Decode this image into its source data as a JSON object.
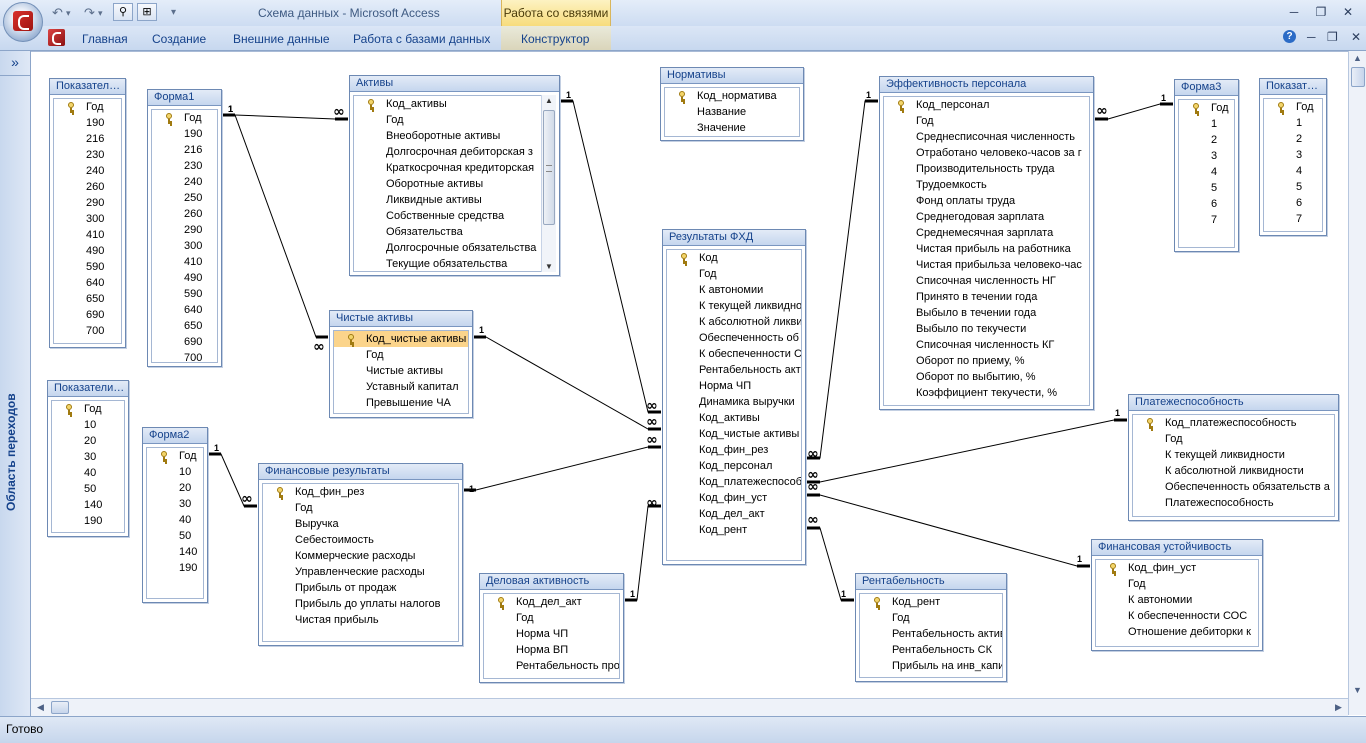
{
  "window": {
    "title": "Схема данных - Microsoft Access",
    "context_tab": "Работа со связями"
  },
  "ribbon": {
    "tabs": [
      "Главная",
      "Создание",
      "Внешние данные",
      "Работа с базами данных",
      "Конструктор"
    ]
  },
  "nav_pane": {
    "label": "Область переходов"
  },
  "status": {
    "text": "Готово"
  },
  "tables": [
    {
      "id": "pokaz1",
      "title": "Показател…",
      "fields": [
        {
          "n": "Год",
          "k": true
        },
        {
          "n": "190"
        },
        {
          "n": "216"
        },
        {
          "n": "230"
        },
        {
          "n": "240"
        },
        {
          "n": "260"
        },
        {
          "n": "290"
        },
        {
          "n": "300"
        },
        {
          "n": "410"
        },
        {
          "n": "490"
        },
        {
          "n": "590"
        },
        {
          "n": "640"
        },
        {
          "n": "650"
        },
        {
          "n": "690"
        },
        {
          "n": "700"
        }
      ]
    },
    {
      "id": "forma1",
      "title": "Форма1",
      "fields": [
        {
          "n": "Год",
          "k": true
        },
        {
          "n": "190"
        },
        {
          "n": "216"
        },
        {
          "n": "230"
        },
        {
          "n": "240"
        },
        {
          "n": "250"
        },
        {
          "n": "260"
        },
        {
          "n": "290"
        },
        {
          "n": "300"
        },
        {
          "n": "410"
        },
        {
          "n": "490"
        },
        {
          "n": "590"
        },
        {
          "n": "640"
        },
        {
          "n": "650"
        },
        {
          "n": "690"
        },
        {
          "n": "700"
        }
      ]
    },
    {
      "id": "aktivy",
      "title": "Активы",
      "fields": [
        {
          "n": "Код_активы",
          "k": true
        },
        {
          "n": "Год"
        },
        {
          "n": "Внеоборотные активы"
        },
        {
          "n": "Долгосрочная дебиторская з"
        },
        {
          "n": "Краткосрочная кредиторская"
        },
        {
          "n": "Оборотные активы"
        },
        {
          "n": "Ликвидные активы"
        },
        {
          "n": "Собственные средства"
        },
        {
          "n": "Обязательства"
        },
        {
          "n": "Долгосрочные обязательства"
        },
        {
          "n": "Текущие обязательства"
        }
      ]
    },
    {
      "id": "normativy",
      "title": "Нормативы",
      "fields": [
        {
          "n": "Код_норматива",
          "k": true
        },
        {
          "n": "Название"
        },
        {
          "n": "Значение"
        }
      ]
    },
    {
      "id": "effekt",
      "title": "Эффективность персонала",
      "fields": [
        {
          "n": "Код_персонал",
          "k": true
        },
        {
          "n": "Год"
        },
        {
          "n": "Среднесписочная численность"
        },
        {
          "n": "Отработано человеко-часов за г"
        },
        {
          "n": "Производительность труда"
        },
        {
          "n": "Трудоемкость"
        },
        {
          "n": "Фонд оплаты труда"
        },
        {
          "n": "Среднегодовая зарплата"
        },
        {
          "n": "Среднемесячная зарплата"
        },
        {
          "n": "Чистая прибыль на работника"
        },
        {
          "n": "Чистая прибыльза человеко-час"
        },
        {
          "n": "Списочная численность НГ"
        },
        {
          "n": "Принято в течении года"
        },
        {
          "n": "Выбыло в течении года"
        },
        {
          "n": "Выбыло по текучести"
        },
        {
          "n": "Списочная численность КГ"
        },
        {
          "n": "Оборот по приему, %"
        },
        {
          "n": "Оборот по выбытию, %"
        },
        {
          "n": "Коэффициент текучести, %"
        }
      ]
    },
    {
      "id": "forma3",
      "title": "Форма3",
      "fields": [
        {
          "n": "Год",
          "k": true
        },
        {
          "n": "1"
        },
        {
          "n": "2"
        },
        {
          "n": "3"
        },
        {
          "n": "4"
        },
        {
          "n": "5"
        },
        {
          "n": "6"
        },
        {
          "n": "7"
        }
      ]
    },
    {
      "id": "pokaz3",
      "title": "Показат…",
      "fields": [
        {
          "n": "Год",
          "k": true
        },
        {
          "n": "1"
        },
        {
          "n": "2"
        },
        {
          "n": "3"
        },
        {
          "n": "4"
        },
        {
          "n": "5"
        },
        {
          "n": "6"
        },
        {
          "n": "7"
        }
      ]
    },
    {
      "id": "chistye",
      "title": "Чистые активы",
      "fields": [
        {
          "n": "Код_чистые активы",
          "k": true,
          "sel": true
        },
        {
          "n": "Год"
        },
        {
          "n": "Чистые активы"
        },
        {
          "n": "Уставный капитал"
        },
        {
          "n": "Превышение ЧА"
        }
      ]
    },
    {
      "id": "rezfhd",
      "title": "Результаты ФХД",
      "fields": [
        {
          "n": "Код",
          "k": true
        },
        {
          "n": "Год"
        },
        {
          "n": "К автономии"
        },
        {
          "n": "К текущей ликвидност"
        },
        {
          "n": "К абсолютной ликви"
        },
        {
          "n": "Обеспеченность об"
        },
        {
          "n": "К обеспеченности С"
        },
        {
          "n": "Рентабельность акт"
        },
        {
          "n": "Норма ЧП"
        },
        {
          "n": "Динамика выручки"
        },
        {
          "n": "Код_активы"
        },
        {
          "n": "Код_чистые активы"
        },
        {
          "n": "Код_фин_рез"
        },
        {
          "n": "Код_персонал"
        },
        {
          "n": "Код_платежеспособ"
        },
        {
          "n": "Код_фин_уст"
        },
        {
          "n": "Код_дел_акт"
        },
        {
          "n": "Код_рент"
        }
      ]
    },
    {
      "id": "pokaz2",
      "title": "Показатели…",
      "fields": [
        {
          "n": "Год",
          "k": true
        },
        {
          "n": "10"
        },
        {
          "n": "20"
        },
        {
          "n": "30"
        },
        {
          "n": "40"
        },
        {
          "n": "50"
        },
        {
          "n": "140"
        },
        {
          "n": "190"
        }
      ]
    },
    {
      "id": "forma2",
      "title": "Форма2",
      "fields": [
        {
          "n": "Год",
          "k": true
        },
        {
          "n": "10"
        },
        {
          "n": "20"
        },
        {
          "n": "30"
        },
        {
          "n": "40"
        },
        {
          "n": "50"
        },
        {
          "n": "140"
        },
        {
          "n": "190"
        }
      ]
    },
    {
      "id": "finrez",
      "title": "Финансовые результаты",
      "fields": [
        {
          "n": "Код_фин_рез",
          "k": true
        },
        {
          "n": "Год"
        },
        {
          "n": "Выручка"
        },
        {
          "n": "Себестоимость"
        },
        {
          "n": "Коммерческие расходы"
        },
        {
          "n": "Управленческие расходы"
        },
        {
          "n": "Прибыль от продаж"
        },
        {
          "n": "Прибыль до уплаты налогов"
        },
        {
          "n": "Чистая прибыль"
        }
      ]
    },
    {
      "id": "delakt",
      "title": "Деловая активность",
      "fields": [
        {
          "n": "Код_дел_акт",
          "k": true
        },
        {
          "n": "Год"
        },
        {
          "n": "Норма ЧП"
        },
        {
          "n": "Норма ВП"
        },
        {
          "n": "Рентабельность про"
        }
      ]
    },
    {
      "id": "rent",
      "title": "Рентабельность",
      "fields": [
        {
          "n": "Код_рент",
          "k": true
        },
        {
          "n": "Год"
        },
        {
          "n": "Рентабельность активо"
        },
        {
          "n": "Рентабельность СК"
        },
        {
          "n": "Прибыль на инв_капит"
        }
      ]
    },
    {
      "id": "platezh",
      "title": "Платежеспособность",
      "fields": [
        {
          "n": "Код_платежеспособность",
          "k": true
        },
        {
          "n": "Год"
        },
        {
          "n": "К текущей ликвидности"
        },
        {
          "n": "К абсолютной ликвидности"
        },
        {
          "n": "Обеспеченность обязательств а"
        },
        {
          "n": "Платежеспособность"
        }
      ]
    },
    {
      "id": "finust",
      "title": "Финансовая устойчивость",
      "fields": [
        {
          "n": "Код_фин_уст",
          "k": true
        },
        {
          "n": "Год"
        },
        {
          "n": "К автономии"
        },
        {
          "n": "К обеспеченности СОС"
        },
        {
          "n": "Отношение дебиторки к"
        }
      ]
    }
  ],
  "relationships": [
    {
      "from": "forma1",
      "to": "aktivy",
      "from_card": "1",
      "to_card": "∞"
    },
    {
      "from": "forma1",
      "to": "chistye",
      "from_card": "1",
      "to_card": "∞"
    },
    {
      "from": "aktivy",
      "to": "rezfhd",
      "from_card": "1",
      "to_card": "∞"
    },
    {
      "from": "chistye",
      "to": "rezfhd",
      "from_card": "1",
      "to_card": "∞"
    },
    {
      "from": "finrez",
      "to": "rezfhd",
      "from_card": "1",
      "to_card": "∞"
    },
    {
      "from": "delakt",
      "to": "rezfhd",
      "from_card": "1",
      "to_card": "∞"
    },
    {
      "from": "forma2",
      "to": "finrez",
      "from_card": "1",
      "to_card": "∞"
    },
    {
      "from": "effekt",
      "to": "rezfhd",
      "from_card": "1",
      "to_card": "∞"
    },
    {
      "from": "forma3",
      "to": "effekt",
      "from_card": "1",
      "to_card": "∞"
    },
    {
      "from": "platezh",
      "to": "rezfhd",
      "from_card": "1",
      "to_card": "∞"
    },
    {
      "from": "finust",
      "to": "rezfhd",
      "from_card": "1",
      "to_card": "∞"
    },
    {
      "from": "rent",
      "to": "rezfhd",
      "from_card": "1",
      "to_card": "∞"
    }
  ]
}
